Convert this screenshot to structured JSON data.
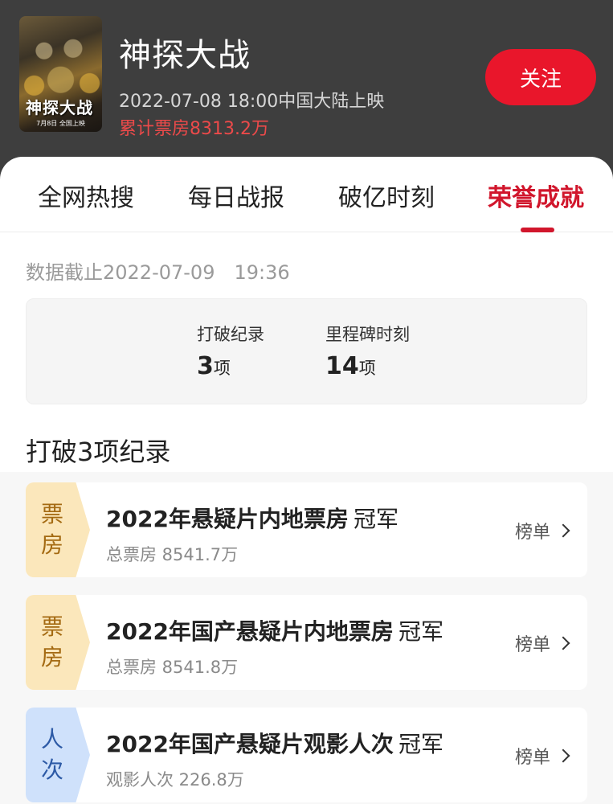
{
  "header": {
    "poster_title": "神探大战",
    "poster_sub": "7月8日 全国上映",
    "movie_title": "神探大战",
    "release": "2022-07-08 18:00中国大陆上映",
    "boxoffice": "累计票房8313.2万",
    "follow_label": "关注"
  },
  "tabs": [
    {
      "label": "全网热搜"
    },
    {
      "label": "每日战报"
    },
    {
      "label": "破亿时刻"
    },
    {
      "label": "荣誉成就",
      "active": true
    }
  ],
  "cutoff": "数据截止2022-07-09　19:36",
  "summary": {
    "records_label": "打破纪录",
    "records_value": "3",
    "records_unit": "项",
    "milestones_label": "里程碑时刻",
    "milestones_value": "14",
    "milestones_unit": "项"
  },
  "section_title": "打破3项纪录",
  "records": [
    {
      "tag_1": "票",
      "tag_2": "房",
      "title": "2022年悬疑片内地票房",
      "rank": "冠军",
      "sub": "总票房 8541.7万",
      "link": "榜单",
      "tag_color": "#fbe7bb"
    },
    {
      "tag_1": "票",
      "tag_2": "房",
      "title": "2022年国产悬疑片内地票房",
      "rank": "冠军",
      "sub": "总票房 8541.8万",
      "link": "榜单",
      "tag_color": "#fbe7bb"
    },
    {
      "tag_1": "人",
      "tag_2": "次",
      "title": "2022年国产悬疑片观影人次",
      "rank": "冠军",
      "sub": "观影人次 226.8万",
      "link": "榜单",
      "tag_color": "#cfe1fb"
    }
  ],
  "colors": {
    "accent": "#d1162c",
    "follow_button": "#e9162b",
    "boxoffice": "#ec4a4a"
  }
}
